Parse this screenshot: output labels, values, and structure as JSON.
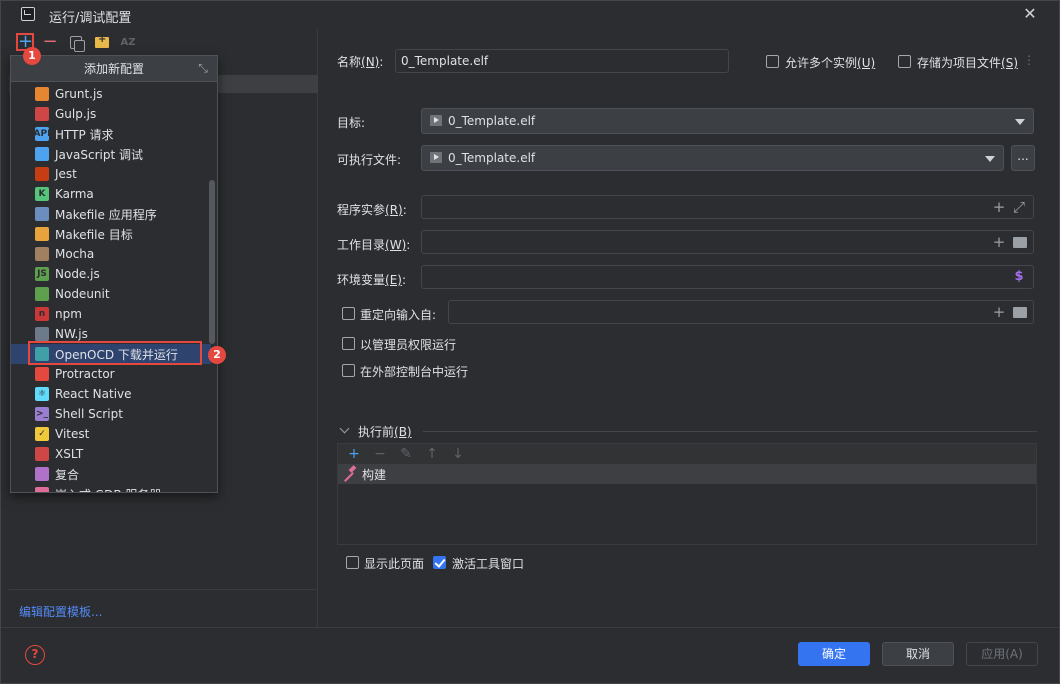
{
  "window": {
    "title": "运行/调试配置",
    "close_glyph": "✕"
  },
  "toolbar": {
    "add_glyph": "+",
    "remove_glyph": "−",
    "sort_label": "AZ"
  },
  "badges": {
    "first": "1",
    "second": "2"
  },
  "popup": {
    "title": "添加新配置",
    "collapse_glyph": "⤡",
    "items": [
      {
        "label": "Grunt.js",
        "icon": "grunt-icon",
        "color": "#e48632",
        "glyph": ""
      },
      {
        "label": "Gulp.js",
        "icon": "gulp-icon",
        "color": "#cf4647",
        "glyph": ""
      },
      {
        "label": "HTTP 请求",
        "icon": "http-icon",
        "color": "#4ea3f0",
        "glyph": "API"
      },
      {
        "label": "JavaScript 调试",
        "icon": "js-debug-icon",
        "color": "#4ea3f0",
        "glyph": ""
      },
      {
        "label": "Jest",
        "icon": "jest-icon",
        "color": "#c63d14",
        "glyph": ""
      },
      {
        "label": "Karma",
        "icon": "karma-icon",
        "color": "#56c47a",
        "glyph": "K"
      },
      {
        "label": "Makefile 应用程序",
        "icon": "makefile-app-icon",
        "color": "#6c8ebf",
        "glyph": ""
      },
      {
        "label": "Makefile 目标",
        "icon": "makefile-target-icon",
        "color": "#e8a33d",
        "glyph": ""
      },
      {
        "label": "Mocha",
        "icon": "mocha-icon",
        "color": "#a08060",
        "glyph": ""
      },
      {
        "label": "Node.js",
        "icon": "nodejs-icon",
        "color": "#5fa04e",
        "glyph": "JS"
      },
      {
        "label": "Nodeunit",
        "icon": "nodeunit-icon",
        "color": "#5fa04e",
        "glyph": ""
      },
      {
        "label": "npm",
        "icon": "npm-icon",
        "color": "#cb3837",
        "glyph": "n"
      },
      {
        "label": "NW.js",
        "icon": "nwjs-icon",
        "color": "#6c7a89",
        "glyph": ""
      },
      {
        "label": "OpenOCD 下载并运行",
        "icon": "openocd-icon",
        "color": "#3fa0a8",
        "glyph": "",
        "selected": true
      },
      {
        "label": "Protractor",
        "icon": "protractor-icon",
        "color": "#e5483f",
        "glyph": ""
      },
      {
        "label": "React Native",
        "icon": "react-native-icon",
        "color": "#61dafb",
        "glyph": "⚛"
      },
      {
        "label": "Shell Script",
        "icon": "shell-script-icon",
        "color": "#9a7fd1",
        "glyph": ">_"
      },
      {
        "label": "Vitest",
        "icon": "vitest-icon",
        "color": "#f0c93b",
        "glyph": "✓"
      },
      {
        "label": "XSLT",
        "icon": "xslt-icon",
        "color": "#cf4647",
        "glyph": ""
      },
      {
        "label": "复合",
        "icon": "compound-icon",
        "color": "#b072c8",
        "glyph": ""
      },
      {
        "label": "嵌入式 GDB 服务器",
        "icon": "gdb-server-icon",
        "color": "#e06c9a",
        "glyph": ""
      }
    ]
  },
  "left": {
    "edit_templates_link": "编辑配置模板..."
  },
  "form": {
    "name_label": "名称",
    "name_key": "(N)",
    "name_value": "0_Template.elf",
    "allow_multiple_label": "允许多个实例",
    "allow_multiple_key": "(U)",
    "store_as_file_label": "存储为项目文件",
    "store_as_file_key": "(S)",
    "more_glyph": "⋮",
    "target_label": "目标:",
    "target_value": "0_Template.elf",
    "executable_label": "可执行文件:",
    "executable_value": "0_Template.elf",
    "browse_label": "...",
    "args_label": "程序实参",
    "args_key": "(R)",
    "workdir_label": "工作目录",
    "workdir_key": "(W)",
    "env_label": "环境变量",
    "env_key": "(E)",
    "redirect_label": "重定向输入自:",
    "run_as_admin_label": "以管理员权限运行",
    "external_console_label": "在外部控制台中运行",
    "plus_glyph": "+",
    "expand_glyph": "⤢",
    "dollar_glyph": "$"
  },
  "before_launch": {
    "label": "执行前",
    "key": "(B)",
    "add_glyph": "+",
    "remove_glyph": "−",
    "edit_glyph": "✎",
    "up_glyph": "↑",
    "down_glyph": "↓",
    "task": "构建",
    "show_page_label": "显示此页面",
    "activate_window_label": "激活工具窗口",
    "show_page_checked": false,
    "activate_window_checked": true
  },
  "footer": {
    "help_glyph": "?",
    "ok_label": "确定",
    "cancel_label": "取消",
    "apply_label": "应用(A)"
  },
  "colors": {
    "accent": "#3574f0",
    "annotation_red": "#e5483f",
    "selection": "#2e436e"
  }
}
